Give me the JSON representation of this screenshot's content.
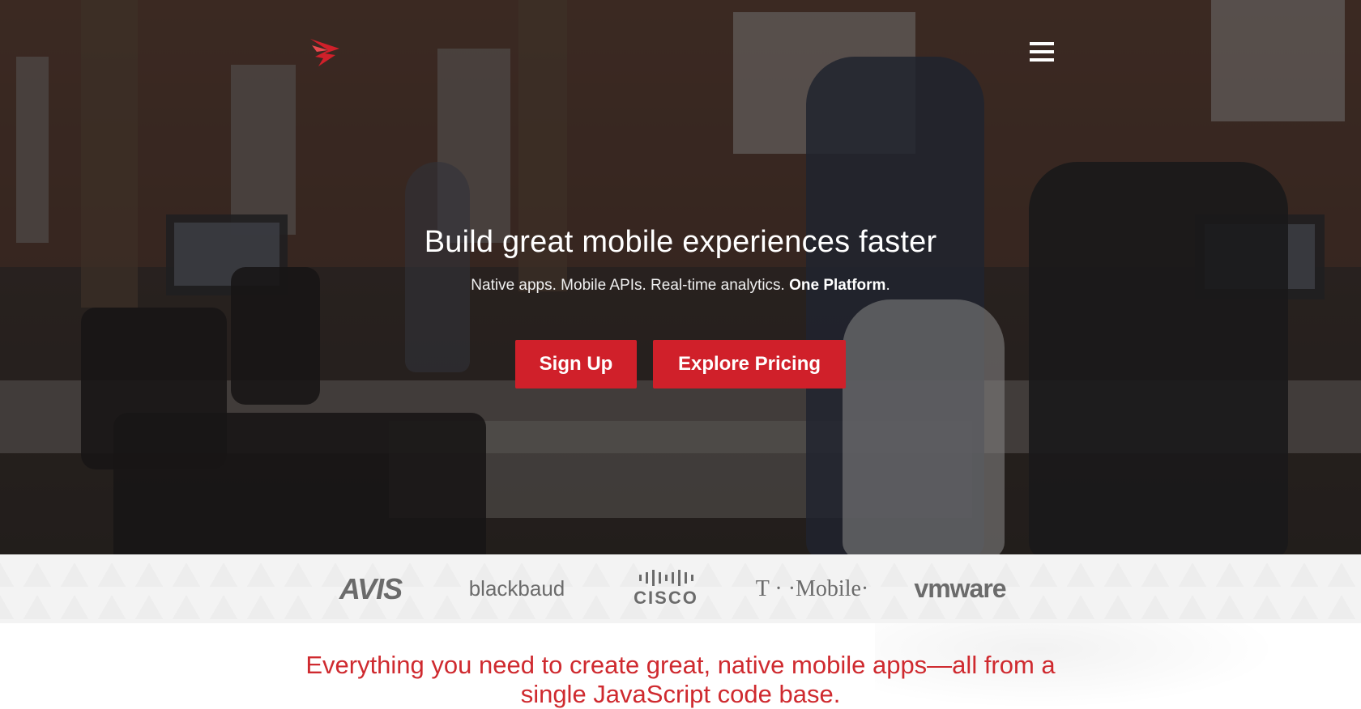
{
  "hero": {
    "title": "Build great mobile experiences faster",
    "subtitle_prefix": "Native apps. Mobile APIs. Real-time analytics. ",
    "subtitle_bold": "One Platform",
    "subtitle_suffix": ".",
    "signup_label": "Sign Up",
    "pricing_label": "Explore Pricing"
  },
  "header": {
    "logo_icon": "appcelerator-logo-icon",
    "menu_icon": "hamburger-menu-icon"
  },
  "clients": {
    "avis": "AVIS",
    "blackbaud": "blackbaud",
    "cisco": "CISCO",
    "tmobile": "T · ·Mobile·",
    "vmware": "vmware"
  },
  "section": {
    "heading": "Everything you need to create great, native mobile apps—all from a single JavaScript code base."
  },
  "colors": {
    "accent": "#d0202a",
    "heading_red": "#cf2a2f",
    "strip_bg": "#f3f3f3",
    "logo_gray": "#6b6b6b"
  }
}
